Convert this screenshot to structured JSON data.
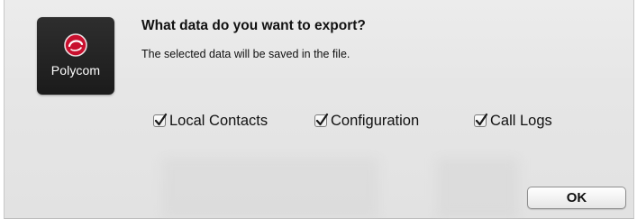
{
  "dialog": {
    "app_icon": {
      "name": "polycom-logo-icon",
      "brand_text": "Polycom"
    },
    "title": "What data do you want to export?",
    "message": "The selected data will be saved in the file.",
    "options": [
      {
        "label": "Local Contacts",
        "checked": true
      },
      {
        "label": "Configuration",
        "checked": true
      },
      {
        "label": "Call Logs",
        "checked": true
      }
    ],
    "ok_label": "OK"
  },
  "colors": {
    "dialog_background": "#e6e6e6",
    "icon_background": "#222222",
    "logo_red": "#c8102e"
  }
}
